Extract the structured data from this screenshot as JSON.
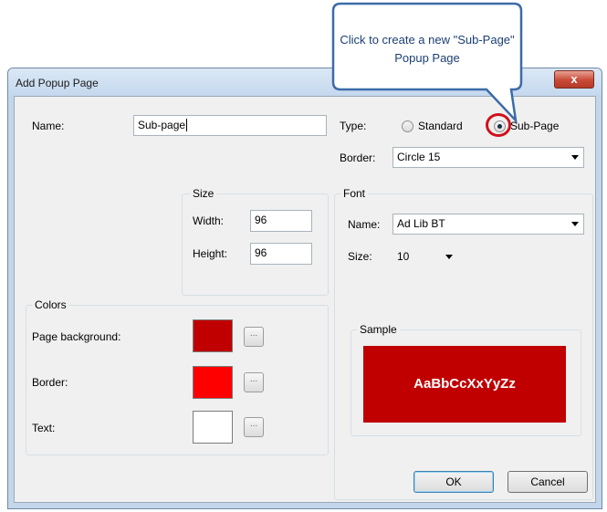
{
  "window": {
    "title": "Add Popup Page",
    "close_label": "x"
  },
  "callout": {
    "text": "Click to create a new \"Sub-Page\" Popup Page"
  },
  "name": {
    "label": "Name:",
    "value": "Sub-page"
  },
  "type": {
    "label": "Type:",
    "options": [
      "Standard",
      "Sub-Page"
    ],
    "selected": "Sub-Page"
  },
  "border": {
    "label": "Border:",
    "value": "Circle 15"
  },
  "size": {
    "title": "Size",
    "width_label": "Width:",
    "width_value": "96",
    "height_label": "Height:",
    "height_value": "96"
  },
  "font": {
    "title": "Font",
    "name_label": "Name:",
    "name_value": "Ad Lib BT",
    "size_label": "Size:",
    "size_value": "10"
  },
  "colors": {
    "title": "Colors",
    "items": [
      {
        "label": "Page background:",
        "color": "#c00000"
      },
      {
        "label": "Border:",
        "color": "#ff0000"
      },
      {
        "label": "Text:",
        "color": "#ffffff"
      }
    ],
    "picker_label": "..."
  },
  "sample": {
    "title": "Sample",
    "text": "AaBbCcXxYyZz",
    "background": "#c00000",
    "text_color": "#ffffff"
  },
  "buttons": {
    "ok": "OK",
    "cancel": "Cancel"
  },
  "accent": {
    "callout_border": "#3d6ba8",
    "highlight_ring": "#d0101a"
  }
}
